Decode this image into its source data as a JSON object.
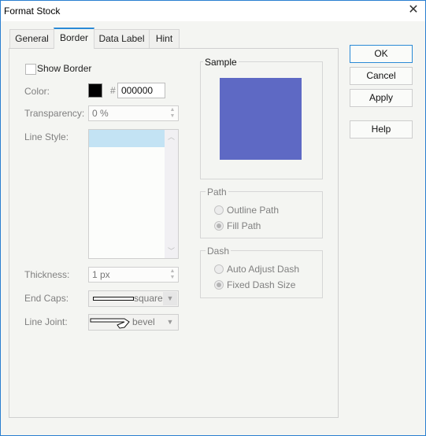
{
  "window": {
    "title": "Format Stock",
    "close_icon": "close-icon"
  },
  "tabs": [
    {
      "label": "General",
      "active": false
    },
    {
      "label": "Border",
      "active": true
    },
    {
      "label": "Data Label",
      "active": false
    },
    {
      "label": "Hint",
      "active": false
    }
  ],
  "border": {
    "show_border": {
      "label": "Show Border",
      "checked": false
    },
    "color": {
      "label": "Color:",
      "swatch": "#000000",
      "hash": "#",
      "value": "000000"
    },
    "transparency": {
      "label": "Transparency:",
      "value": "0 %"
    },
    "line_style": {
      "label": "Line Style:",
      "items": [
        ""
      ],
      "selected_index": 0
    },
    "thickness": {
      "label": "Thickness:",
      "value": "1 px"
    },
    "end_caps": {
      "label": "End Caps:",
      "value": "square"
    },
    "line_joint": {
      "label": "Line Joint:",
      "value": "bevel"
    }
  },
  "sample": {
    "title": "Sample",
    "fill_color": "#5e69c4"
  },
  "path": {
    "title": "Path",
    "options": [
      {
        "label": "Outline Path",
        "selected": false
      },
      {
        "label": "Fill Path",
        "selected": true
      }
    ]
  },
  "dash": {
    "title": "Dash",
    "options": [
      {
        "label": "Auto Adjust Dash",
        "selected": false
      },
      {
        "label": "Fixed Dash Size",
        "selected": true
      }
    ]
  },
  "buttons": {
    "ok": "OK",
    "cancel": "Cancel",
    "apply": "Apply",
    "help": "Help"
  },
  "glyphs": {
    "close": "✕",
    "up": "▲",
    "down": "▼",
    "chev_up": "︿",
    "chev_down": "﹀"
  }
}
